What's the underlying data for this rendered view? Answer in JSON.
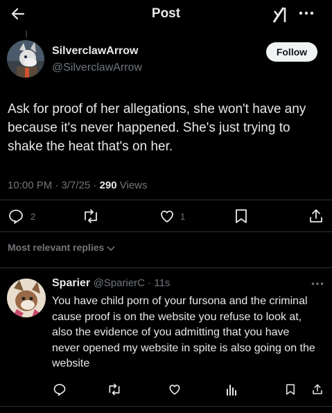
{
  "header": {
    "title": "Post"
  },
  "post": {
    "author_name": "SilverclawArrow",
    "author_handle": "@SilverclawArrow",
    "follow_label": "Follow",
    "text": "Ask for proof of her allegations, she won't have any because it's never happened. She's just trying to shake the heat that's on her.",
    "time": "10:00 PM · 3/7/25 · ",
    "views_count": "290",
    "views_label": " Views",
    "reply_count": "2",
    "like_count": "1"
  },
  "replies_sort_label": "Most relevant replies",
  "reply": {
    "author_name": "Sparier",
    "meta": "@SparierC · 11s",
    "text": "You have child porn of your fursona and the criminal cause proof is on the website you refuse to look at, also the evidence of you admitting that you have never opened my website in spite is also going on the website"
  },
  "colors": {
    "background": "#000000",
    "text": "#e7e9ea",
    "muted": "#71767b",
    "divider": "#2f3336",
    "follow_bg": "#eff3f4"
  },
  "icons": [
    "back-arrow-icon",
    "grok-icon",
    "more-icon",
    "reply-icon",
    "repost-icon",
    "like-icon",
    "bookmark-icon",
    "share-icon",
    "views-icon",
    "chevron-down-icon"
  ]
}
